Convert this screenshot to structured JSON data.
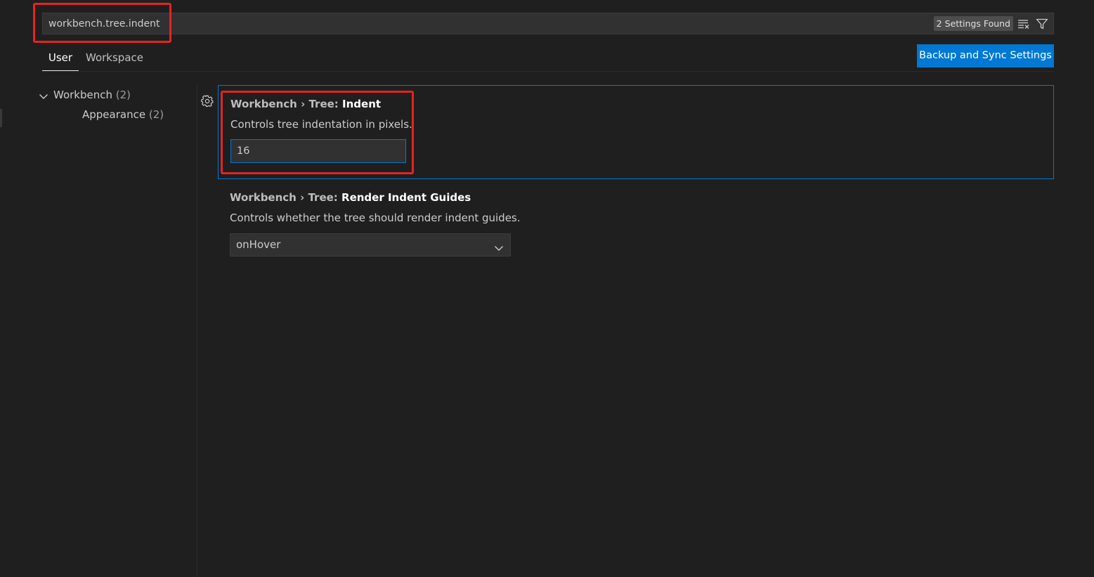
{
  "search": {
    "value": "workbench.tree.indent",
    "results_badge": "2 Settings Found",
    "clear_icon": "clear-filter-icon",
    "filter_icon": "filter-icon"
  },
  "tabs": [
    {
      "label": "User",
      "active": true
    },
    {
      "label": "Workspace",
      "active": false
    }
  ],
  "sync_button": {
    "label": "Backup and Sync Settings"
  },
  "toc": {
    "items": [
      {
        "label": "Workbench",
        "count": "(2)",
        "expanded": true
      },
      {
        "label": "Appearance",
        "count": "(2)"
      }
    ]
  },
  "settings": [
    {
      "category": "Workbench › Tree: ",
      "name": "Indent",
      "description": "Controls tree indentation in pixels.",
      "value": "16",
      "control": "number-input"
    },
    {
      "category": "Workbench › Tree: ",
      "name": "Render Indent Guides",
      "description": "Controls whether the tree should render indent guides.",
      "value": "onHover",
      "control": "select"
    }
  ],
  "colors": {
    "background": "#1f1f1f",
    "accent": "#0078d4",
    "annotation": "#e52323"
  }
}
